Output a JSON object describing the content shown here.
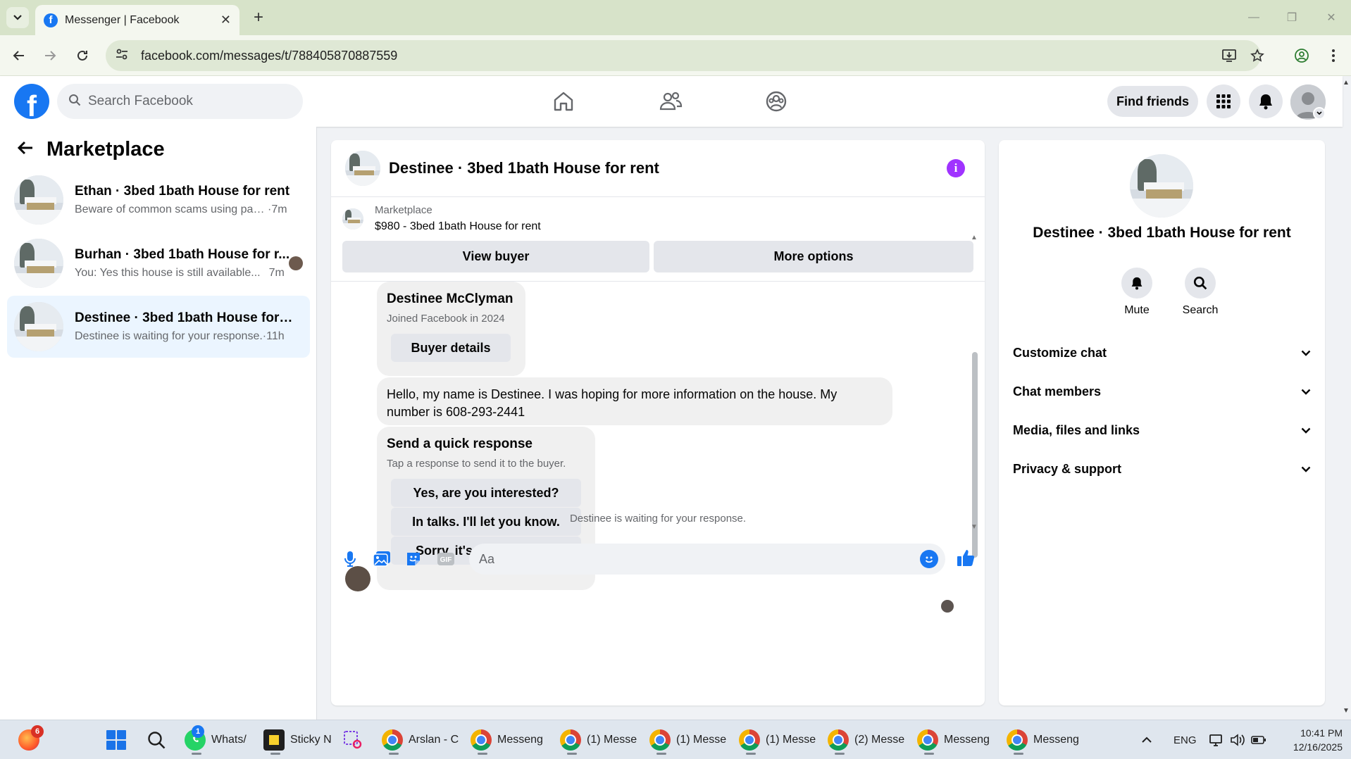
{
  "browser": {
    "tab_title": "Messenger | Facebook",
    "url": "facebook.com/messages/t/788405870887559"
  },
  "fb": {
    "search_placeholder": "Search Facebook",
    "find_friends": "Find friends",
    "brand_color": "#1877f2"
  },
  "sidebar": {
    "title": "Marketplace",
    "conversations": [
      {
        "title": "Ethan · 3bed 1bath House for rent",
        "preview": "Beware of common scams using pay...",
        "time": "·7m"
      },
      {
        "title": "Burhan · 3bed 1bath House for r...",
        "preview": "You: Yes this house is still available...",
        "time": "7m"
      },
      {
        "title": "Destinee · 3bed 1bath House for re...",
        "preview": "Destinee is waiting for your response.",
        "time": "·11h"
      }
    ]
  },
  "chat": {
    "title": "Destinee · 3bed 1bath House for rent",
    "marketplace_label": "Marketplace",
    "listing": "$980 - 3bed 1bath House for rent",
    "view_buyer": "View buyer",
    "more_options": "More options",
    "buyer_card": {
      "name": "Destinee McClyman",
      "joined": "Joined Facebook in 2024",
      "button": "Buyer details"
    },
    "message_line1": "Hello, my name is Destinee. I was hoping for more information on the house. My",
    "message_line2": "number is 608-293-2441",
    "quick": {
      "title": "Send a quick response",
      "subtitle": "Tap a response to send it to the buyer.",
      "options": [
        "Yes, are you interested?",
        "In talks. I'll let you know.",
        "Sorry, it's not available."
      ]
    },
    "waiting": "Destinee is waiting for your response.",
    "composer_placeholder": "Aa"
  },
  "details": {
    "name": "Destinee · 3bed 1bath House for rent",
    "mute": "Mute",
    "search": "Search",
    "sections": [
      "Customize chat",
      "Chat members",
      "Media, files and links",
      "Privacy & support"
    ]
  },
  "taskbar": {
    "badge_firefox": "6",
    "badge_whatsapp": "1",
    "items": [
      "Whats/",
      "Sticky N",
      "Arslan - C",
      "Messeng",
      "(1) Messe",
      "(1) Messe",
      "(1) Messe",
      "(2) Messe",
      "Messeng",
      "Messeng"
    ],
    "lang": "ENG",
    "time": "10:41 PM",
    "date": "12/16/2025"
  }
}
